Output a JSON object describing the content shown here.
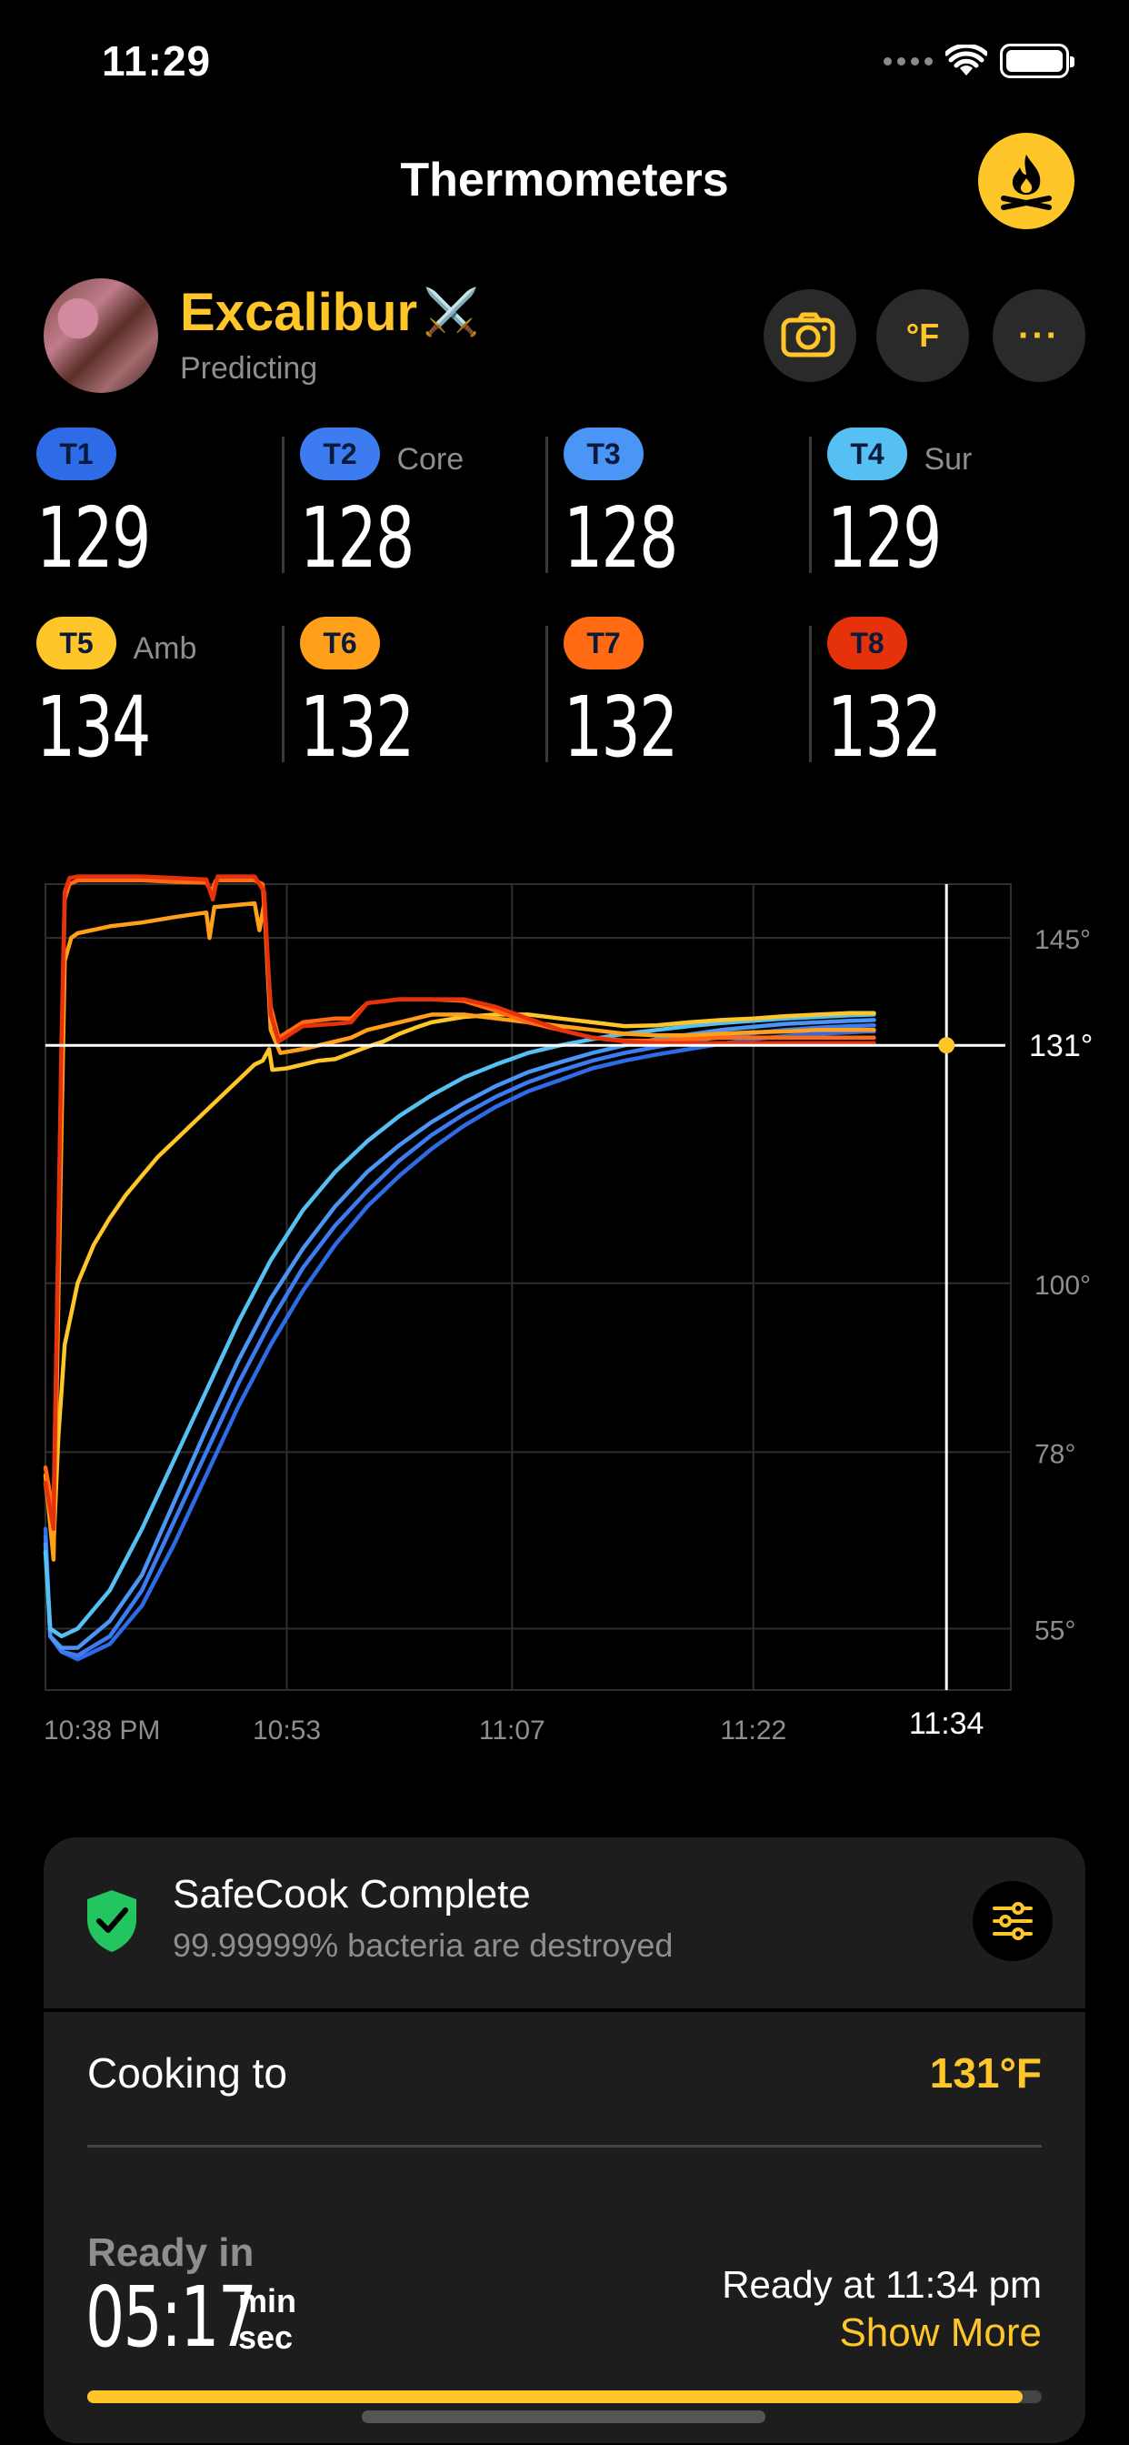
{
  "status_bar": {
    "time": "11:29"
  },
  "header": {
    "title": "Thermometers",
    "fire_icon": "campfire-icon"
  },
  "device": {
    "name": "Excalibur",
    "emoji": "⚔️",
    "status": "Predicting",
    "unit_label": "°F",
    "more_label": "···"
  },
  "sensors": [
    {
      "id": "T1",
      "tag": "",
      "value": "129",
      "color": "#2E6BE6"
    },
    {
      "id": "T2",
      "tag": "Core",
      "value": "128",
      "color": "#3D7CF0"
    },
    {
      "id": "T3",
      "tag": "",
      "value": "128",
      "color": "#4A95F5"
    },
    {
      "id": "T4",
      "tag": "Sur",
      "value": "129",
      "color": "#56C0F2"
    },
    {
      "id": "T5",
      "tag": "Amb",
      "value": "134",
      "color": "#FFC629"
    },
    {
      "id": "T6",
      "tag": "",
      "value": "132",
      "color": "#FF9F1A"
    },
    {
      "id": "T7",
      "tag": "",
      "value": "132",
      "color": "#FF6A13"
    },
    {
      "id": "T8",
      "tag": "",
      "value": "132",
      "color": "#E5320B"
    }
  ],
  "chart_data": {
    "type": "line",
    "x_ticks": [
      "10:38 PM",
      "10:53",
      "11:07",
      "11:22",
      "11:34"
    ],
    "x_tick_minutes": [
      0,
      15,
      29,
      44,
      56
    ],
    "x_range": [
      0,
      60
    ],
    "y_ticks": [
      145,
      131,
      100,
      78,
      55
    ],
    "y_tick_labels": [
      "145°",
      "131°",
      "100°",
      "78°",
      "55°"
    ],
    "y_range": [
      47,
      152
    ],
    "target": 131,
    "target_label": "131°",
    "predicted_time_label": "11:34",
    "grid": true,
    "series": [
      {
        "id": "T1",
        "color": "#2E6BE6",
        "points": [
          [
            0,
            68
          ],
          [
            0.3,
            54
          ],
          [
            1,
            52
          ],
          [
            2,
            51
          ],
          [
            4,
            53
          ],
          [
            6,
            58
          ],
          [
            8,
            66
          ],
          [
            10,
            75
          ],
          [
            12,
            84
          ],
          [
            14,
            92
          ],
          [
            16,
            99
          ],
          [
            18,
            105
          ],
          [
            20,
            110
          ],
          [
            22,
            114
          ],
          [
            24,
            117.5
          ],
          [
            26,
            120.5
          ],
          [
            28,
            123
          ],
          [
            30,
            125
          ],
          [
            32,
            126.5
          ],
          [
            34,
            128
          ],
          [
            36,
            129
          ],
          [
            38,
            129.8
          ],
          [
            40,
            130.5
          ],
          [
            42,
            131.2
          ],
          [
            44,
            131.8
          ],
          [
            46,
            132.2
          ],
          [
            47,
            132.4
          ],
          [
            49,
            132.6
          ],
          [
            51,
            132.8
          ],
          [
            51.5,
            132.8
          ]
        ]
      },
      {
        "id": "T2",
        "color": "#3D7CF0",
        "points": [
          [
            0,
            67
          ],
          [
            0.3,
            54
          ],
          [
            1,
            52
          ],
          [
            2,
            51.5
          ],
          [
            4,
            54
          ],
          [
            6,
            60
          ],
          [
            8,
            69
          ],
          [
            10,
            78
          ],
          [
            12,
            87
          ],
          [
            14,
            95
          ],
          [
            16,
            102
          ],
          [
            18,
            107.5
          ],
          [
            20,
            112
          ],
          [
            22,
            116
          ],
          [
            24,
            119.3
          ],
          [
            26,
            122
          ],
          [
            28,
            124.3
          ],
          [
            30,
            126.2
          ],
          [
            32,
            127.7
          ],
          [
            34,
            129
          ],
          [
            36,
            130
          ],
          [
            38,
            130.8
          ],
          [
            40,
            131.5
          ],
          [
            42,
            132.1
          ],
          [
            44,
            132.6
          ],
          [
            46,
            133
          ],
          [
            48,
            133.3
          ],
          [
            50,
            133.5
          ],
          [
            51.5,
            133.6
          ]
        ]
      },
      {
        "id": "T3",
        "color": "#4A95F5",
        "points": [
          [
            0,
            66
          ],
          [
            0.3,
            54
          ],
          [
            1,
            52.5
          ],
          [
            2,
            52.5
          ],
          [
            4,
            56
          ],
          [
            6,
            62
          ],
          [
            8,
            71.5
          ],
          [
            10,
            81
          ],
          [
            12,
            90
          ],
          [
            14,
            98
          ],
          [
            16,
            104.5
          ],
          [
            18,
            110
          ],
          [
            20,
            114.5
          ],
          [
            22,
            118
          ],
          [
            24,
            121
          ],
          [
            26,
            123.5
          ],
          [
            28,
            125.7
          ],
          [
            30,
            127.5
          ],
          [
            32,
            128.8
          ],
          [
            34,
            130
          ],
          [
            36,
            131
          ],
          [
            38,
            131.8
          ],
          [
            40,
            132.4
          ],
          [
            42,
            133
          ],
          [
            44,
            133.4
          ],
          [
            46,
            133.8
          ],
          [
            48,
            134
          ],
          [
            50,
            134.2
          ],
          [
            51.5,
            134.3
          ]
        ]
      },
      {
        "id": "T4",
        "color": "#56C0F2",
        "points": [
          [
            0,
            65
          ],
          [
            0.3,
            55
          ],
          [
            1,
            54
          ],
          [
            2,
            55
          ],
          [
            4,
            60
          ],
          [
            6,
            68
          ],
          [
            8,
            77
          ],
          [
            10,
            86
          ],
          [
            12,
            95
          ],
          [
            14,
            103
          ],
          [
            16,
            109.5
          ],
          [
            18,
            114.5
          ],
          [
            20,
            118.5
          ],
          [
            22,
            121.8
          ],
          [
            24,
            124.5
          ],
          [
            26,
            126.8
          ],
          [
            28,
            128.5
          ],
          [
            30,
            130
          ],
          [
            32,
            131
          ],
          [
            34,
            131.8
          ],
          [
            36,
            132.5
          ],
          [
            38,
            133
          ],
          [
            40,
            133.5
          ],
          [
            42,
            133.9
          ],
          [
            44,
            134.2
          ],
          [
            46,
            134.5
          ],
          [
            48,
            134.7
          ],
          [
            50,
            134.9
          ],
          [
            51.5,
            135
          ]
        ]
      },
      {
        "id": "T5",
        "color": "#FFC629",
        "points": [
          [
            0,
            74
          ],
          [
            0.2,
            71
          ],
          [
            0.5,
            66
          ],
          [
            0.8,
            80
          ],
          [
            1.2,
            92
          ],
          [
            2,
            100
          ],
          [
            3,
            105
          ],
          [
            4,
            108.5
          ],
          [
            5,
            111.5
          ],
          [
            6,
            114
          ],
          [
            7,
            116.5
          ],
          [
            8,
            118.5
          ],
          [
            9,
            120.5
          ],
          [
            10,
            122.5
          ],
          [
            11,
            124.5
          ],
          [
            12,
            126.5
          ],
          [
            13,
            128.5
          ],
          [
            13.5,
            129
          ],
          [
            13.9,
            130.5
          ],
          [
            14.1,
            127.8
          ],
          [
            15,
            128
          ],
          [
            16,
            128.5
          ],
          [
            17,
            129
          ],
          [
            18,
            129.2
          ],
          [
            19,
            130
          ],
          [
            20,
            130.8
          ],
          [
            21,
            131.5
          ],
          [
            22,
            132.5
          ],
          [
            23,
            133.3
          ],
          [
            24,
            134
          ],
          [
            26,
            134.7
          ],
          [
            28,
            135
          ],
          [
            30,
            135
          ],
          [
            32,
            134.5
          ],
          [
            34,
            134
          ],
          [
            36,
            133.5
          ],
          [
            38,
            133.6
          ],
          [
            40,
            134
          ],
          [
            42,
            134.3
          ],
          [
            44,
            134.5
          ],
          [
            46,
            134.8
          ],
          [
            48,
            135
          ],
          [
            50,
            135.2
          ],
          [
            51.5,
            135.2
          ]
        ]
      },
      {
        "id": "T6",
        "color": "#FF9F1A",
        "points": [
          [
            0,
            75
          ],
          [
            0.5,
            64
          ],
          [
            1,
            120
          ],
          [
            1.2,
            142
          ],
          [
            1.6,
            145
          ],
          [
            2,
            145.6
          ],
          [
            4,
            146.5
          ],
          [
            6,
            147
          ],
          [
            8,
            147.7
          ],
          [
            10,
            148.3
          ],
          [
            10.2,
            145
          ],
          [
            10.5,
            149
          ],
          [
            12,
            149.3
          ],
          [
            13,
            149.5
          ],
          [
            13.3,
            146
          ],
          [
            13.6,
            149.5
          ],
          [
            14,
            133
          ],
          [
            14.6,
            130
          ],
          [
            16,
            130.5
          ],
          [
            17,
            131
          ],
          [
            18,
            131.5
          ],
          [
            19,
            132
          ],
          [
            20,
            133
          ],
          [
            22,
            134
          ],
          [
            24,
            135
          ],
          [
            26,
            135
          ],
          [
            28,
            134.5
          ],
          [
            30,
            134
          ],
          [
            32,
            133.5
          ],
          [
            34,
            133
          ],
          [
            36,
            132.5
          ],
          [
            38,
            132.3
          ],
          [
            40,
            132.3
          ],
          [
            42,
            132.5
          ],
          [
            44,
            132.7
          ],
          [
            46,
            132.8
          ],
          [
            48,
            133
          ],
          [
            50,
            133
          ],
          [
            51.5,
            133
          ]
        ]
      },
      {
        "id": "T7",
        "color": "#FF6A13",
        "points": [
          [
            0,
            76
          ],
          [
            0.5,
            70
          ],
          [
            1,
            130
          ],
          [
            1.2,
            150
          ],
          [
            1.5,
            152
          ],
          [
            2,
            152.5
          ],
          [
            4,
            152.5
          ],
          [
            6,
            152.5
          ],
          [
            8,
            152.3
          ],
          [
            10,
            152.2
          ],
          [
            10.3,
            151
          ],
          [
            10.6,
            152.5
          ],
          [
            12,
            152.5
          ],
          [
            13,
            152.5
          ],
          [
            13.5,
            152
          ],
          [
            14,
            136
          ],
          [
            14.5,
            132
          ],
          [
            16,
            134
          ],
          [
            18,
            134.5
          ],
          [
            19,
            134.5
          ],
          [
            19.5,
            135.5
          ],
          [
            20,
            136.5
          ],
          [
            22,
            137
          ],
          [
            24,
            137
          ],
          [
            26,
            136.8
          ],
          [
            28,
            135.5
          ],
          [
            30,
            134
          ],
          [
            32,
            133
          ],
          [
            34,
            132
          ],
          [
            36,
            131.6
          ],
          [
            38,
            131.6
          ],
          [
            40,
            131.8
          ],
          [
            42,
            132
          ],
          [
            44,
            132
          ],
          [
            46,
            132
          ],
          [
            48,
            132
          ],
          [
            50,
            132
          ],
          [
            51.5,
            132
          ]
        ]
      },
      {
        "id": "T8",
        "color": "#E5320B",
        "points": [
          [
            0,
            74
          ],
          [
            0.5,
            68
          ],
          [
            1,
            132
          ],
          [
            1.2,
            151
          ],
          [
            1.5,
            152.8
          ],
          [
            2,
            153
          ],
          [
            4,
            153
          ],
          [
            6,
            153
          ],
          [
            8,
            152.8
          ],
          [
            10,
            152.6
          ],
          [
            10.4,
            150
          ],
          [
            10.7,
            153
          ],
          [
            12,
            153
          ],
          [
            13,
            153
          ],
          [
            13.6,
            151
          ],
          [
            14,
            135
          ],
          [
            14.5,
            131.5
          ],
          [
            16,
            133.5
          ],
          [
            18,
            133.8
          ],
          [
            19,
            134
          ],
          [
            19.6,
            135.5
          ],
          [
            20,
            136.5
          ],
          [
            22,
            137
          ],
          [
            24,
            137
          ],
          [
            26,
            137
          ],
          [
            28,
            136
          ],
          [
            30,
            134.5
          ],
          [
            32,
            133
          ],
          [
            34,
            132
          ],
          [
            36,
            131.5
          ],
          [
            38,
            131.3
          ],
          [
            40,
            131.3
          ],
          [
            42,
            131.3
          ],
          [
            44,
            131.3
          ],
          [
            46,
            131.3
          ],
          [
            48,
            131.3
          ],
          [
            50,
            131.3
          ],
          [
            51.5,
            131.3
          ]
        ]
      }
    ]
  },
  "safecook": {
    "title": "SafeCook Complete",
    "subtitle": "99.99999% bacteria are destroyed"
  },
  "cooking": {
    "label": "Cooking to",
    "target": "131°F"
  },
  "ready": {
    "label": "Ready in",
    "time": "05:17",
    "unit_min": "min",
    "unit_sec": "sec",
    "ready_at": "Ready at 11:34 pm",
    "show_more": "Show More",
    "progress": 0.98
  },
  "colors": {
    "accent": "#FFC629",
    "card": "#1D1D1D",
    "target_line": "#FFFFFF"
  }
}
